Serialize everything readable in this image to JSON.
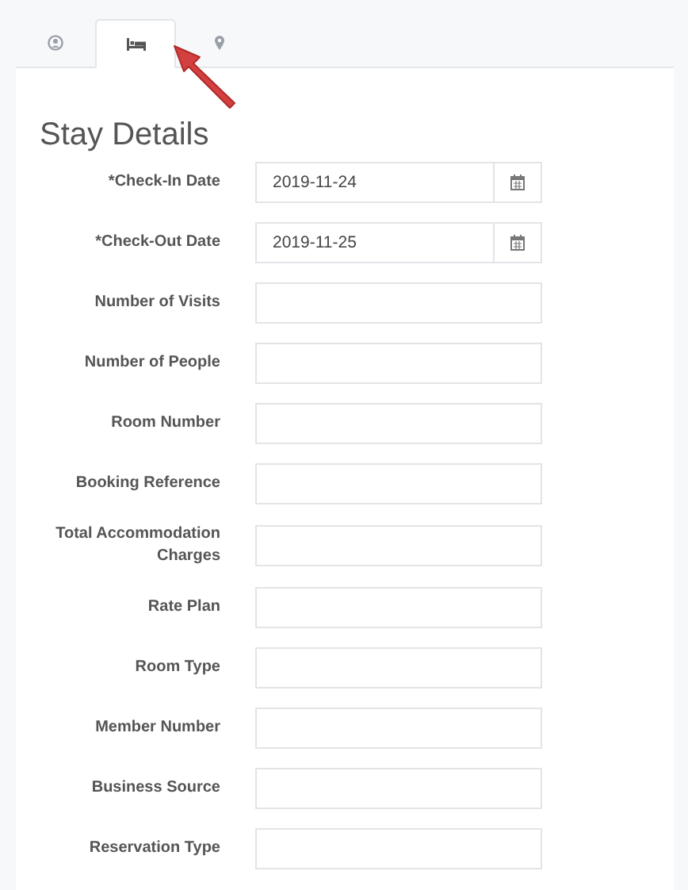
{
  "tabs": [
    {
      "selected": false
    },
    {
      "selected": true
    },
    {
      "selected": false
    }
  ],
  "section": {
    "title": "Stay Details"
  },
  "fields": [
    {
      "label": "*Check-In Date",
      "kind": "date",
      "value": "2019-11-24"
    },
    {
      "label": "*Check-Out Date",
      "kind": "date",
      "value": "2019-11-25"
    },
    {
      "label": "Number of Visits",
      "kind": "text"
    },
    {
      "label": "Number of People",
      "kind": "text"
    },
    {
      "label": "Room Number",
      "kind": "text"
    },
    {
      "label": "Booking Reference",
      "kind": "text"
    },
    {
      "label": "Total Accommodation Charges",
      "kind": "text"
    },
    {
      "label": "Rate Plan",
      "kind": "text"
    },
    {
      "label": "Room Type",
      "kind": "text"
    },
    {
      "label": "Member Number",
      "kind": "text"
    },
    {
      "label": "Business Source",
      "kind": "text"
    },
    {
      "label": "Reservation Type",
      "kind": "text"
    }
  ]
}
